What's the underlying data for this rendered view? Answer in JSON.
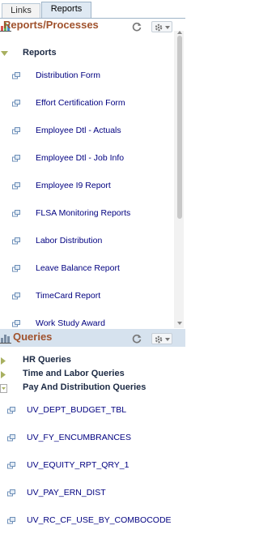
{
  "tabs": [
    {
      "label": "Links"
    },
    {
      "label": "Reports"
    }
  ],
  "reports": {
    "title": "Reports/Processes",
    "folder": "Reports",
    "items": [
      {
        "label": "Distribution Form"
      },
      {
        "label": "Effort Certification Form"
      },
      {
        "label": "Employee Dtl - Actuals"
      },
      {
        "label": "Employee Dtl - Job Info"
      },
      {
        "label": "Employee I9 Report"
      },
      {
        "label": "FLSA Monitoring Reports"
      },
      {
        "label": "Labor Distribution"
      },
      {
        "label": "Leave Balance Report"
      },
      {
        "label": "TimeCard Report"
      },
      {
        "label": "Work Study Award"
      }
    ]
  },
  "queries": {
    "title": "Queries",
    "folders": [
      {
        "label": "HR Queries"
      },
      {
        "label": "Time and Labor Queries"
      },
      {
        "label": "Pay And Distribution Queries"
      }
    ],
    "items": [
      {
        "label": "UV_DEPT_BUDGET_TBL"
      },
      {
        "label": "UV_FY_ENCUMBRANCES"
      },
      {
        "label": "UV_EQUITY_RPT_QRY_1"
      },
      {
        "label": "UV_PAY_ERN_DIST"
      },
      {
        "label": "UV_RC_CF_USE_BY_COMBOCODE"
      }
    ]
  },
  "icons": {
    "chart": "bar-chart-icon",
    "refresh": "refresh-icon",
    "gear": "gear-icon",
    "report": "report-link-icon",
    "expanded": "triangle-down-icon",
    "collapsed": "triangle-right-icon",
    "folder_open": "open-folder-icon"
  },
  "colors": {
    "title": "#a0522d",
    "link": "#000080",
    "band": "#d6e2ee"
  }
}
